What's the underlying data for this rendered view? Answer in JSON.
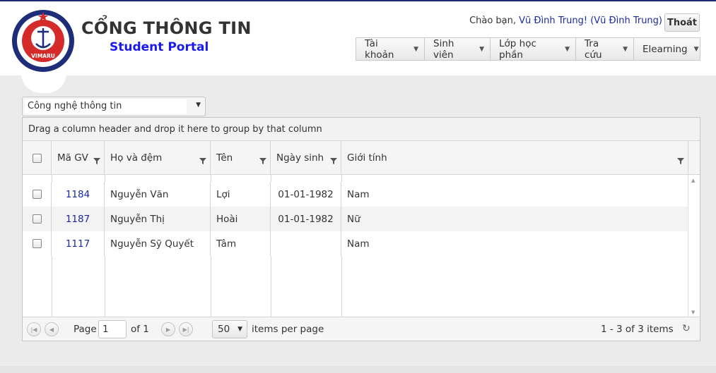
{
  "brand": {
    "logo_text": "VIMARU",
    "title": "CỔNG THÔNG TIN",
    "subtitle": "Student Portal"
  },
  "user": {
    "greeting_prefix": "Chào bạn, ",
    "name_link": "Vũ Đình Trung!",
    "name_paren": "(Vũ Đình Trung)",
    "logout_label": "Thoát"
  },
  "menu": [
    {
      "label": "Tài khoản",
      "icon": "caret-down-icon"
    },
    {
      "label": "Sinh viên",
      "icon": "caret-down-icon"
    },
    {
      "label": "Lớp học phần",
      "icon": "caret-down-icon"
    },
    {
      "label": "Tra cứu",
      "icon": "caret-down-icon"
    },
    {
      "label": "Elearning",
      "icon": "caret-down-icon"
    }
  ],
  "department": {
    "selected": "Công nghệ thông tin"
  },
  "grid": {
    "group_hint": "Drag a column header and drop it here to group by that column",
    "columns": [
      "Mã GV",
      "Họ và đệm",
      "Tên",
      "Ngày sinh",
      "Giới tính"
    ],
    "rows": [
      {
        "id": "1184",
        "last_middle": "Nguyễn Văn",
        "first": "Lợi",
        "dob": "01-01-1982",
        "gender": "Nam"
      },
      {
        "id": "1187",
        "last_middle": "Nguyễn Thị",
        "first": "Hoài",
        "dob": "01-01-1982",
        "gender": "Nữ"
      },
      {
        "id": "1117",
        "last_middle": "Nguyễn Sỹ Quyết",
        "first": "Tâm",
        "dob": "",
        "gender": "Nam"
      }
    ]
  },
  "pager": {
    "page_label": "Page",
    "page_value": "1",
    "of_label": "of 1",
    "page_size": "50",
    "items_per_page_label": "items per page",
    "summary": "1 - 3 of 3 items"
  },
  "colors": {
    "accent_link": "#1a2a9c",
    "subtitle_blue": "#1a1aee",
    "content_bg": "#ebebeb"
  }
}
